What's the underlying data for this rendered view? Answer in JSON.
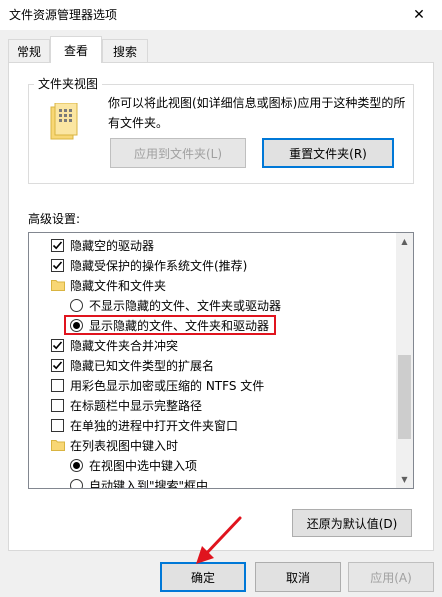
{
  "window": {
    "title": "文件资源管理器选项",
    "close_label": "✕"
  },
  "tabs": [
    {
      "label": "常规"
    },
    {
      "label": "查看"
    },
    {
      "label": "搜索"
    }
  ],
  "folder_views": {
    "title": "文件夹视图",
    "description": "你可以将此视图(如详细信息或图标)应用于这种类型的所有文件夹。",
    "apply_button": "应用到文件夹(L)",
    "reset_button": "重置文件夹(R)"
  },
  "advanced": {
    "label": "高级设置:",
    "items": [
      {
        "type": "checkbox",
        "checked": true,
        "label": "隐藏空的驱动器"
      },
      {
        "type": "checkbox",
        "checked": true,
        "label": "隐藏受保护的操作系统文件(推荐)"
      },
      {
        "type": "folder",
        "label": "隐藏文件和文件夹"
      },
      {
        "type": "radio",
        "checked": false,
        "label": "不显示隐藏的文件、文件夹或驱动器"
      },
      {
        "type": "radio",
        "checked": true,
        "label": "显示隐藏的文件、文件夹和驱动器"
      },
      {
        "type": "checkbox",
        "checked": true,
        "label": "隐藏文件夹合并冲突"
      },
      {
        "type": "checkbox",
        "checked": true,
        "label": "隐藏已知文件类型的扩展名"
      },
      {
        "type": "checkbox",
        "checked": false,
        "label": "用彩色显示加密或压缩的 NTFS 文件"
      },
      {
        "type": "checkbox",
        "checked": false,
        "label": "在标题栏中显示完整路径"
      },
      {
        "type": "checkbox",
        "checked": false,
        "label": "在单独的进程中打开文件夹窗口"
      },
      {
        "type": "folder",
        "label": "在列表视图中键入时"
      },
      {
        "type": "radio",
        "checked": true,
        "label": "在视图中选中键入项"
      },
      {
        "type": "radio",
        "checked": false,
        "label": "自动键入到\"搜索\"框中"
      }
    ],
    "restore_button": "还原为默认值(D)"
  },
  "footer": {
    "ok_button": "确定",
    "cancel_button": "取消",
    "apply_button": "应用(A)"
  },
  "colors": {
    "accent": "#0078d7",
    "highlight": "#e0141e",
    "folder": "#f8d775"
  }
}
